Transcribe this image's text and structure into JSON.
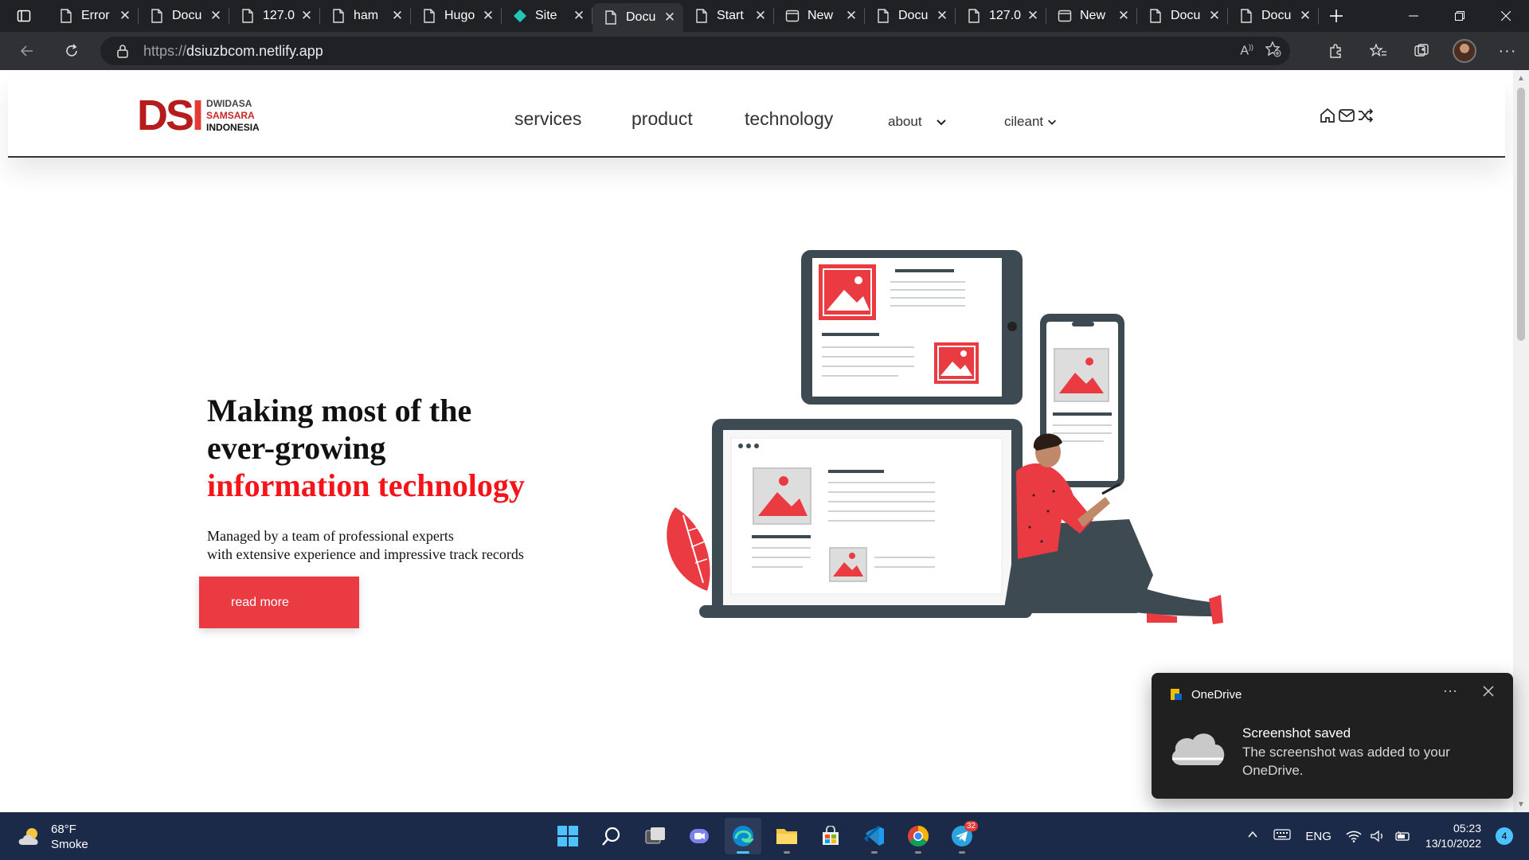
{
  "browser": {
    "tabs": [
      {
        "title": "Error",
        "icon": "page-icon"
      },
      {
        "title": "Docu",
        "icon": "page-icon"
      },
      {
        "title": "127.0",
        "icon": "page-icon"
      },
      {
        "title": "ham",
        "icon": "page-icon"
      },
      {
        "title": "Hugo",
        "icon": "page-icon"
      },
      {
        "title": "Site",
        "icon": "netlify-icon"
      },
      {
        "title": "Docu",
        "icon": "page-icon",
        "active": true
      },
      {
        "title": "Start",
        "icon": "page-icon"
      },
      {
        "title": "New",
        "icon": "newtab-icon"
      },
      {
        "title": "Docu",
        "icon": "page-icon"
      },
      {
        "title": "127.0",
        "icon": "page-icon"
      },
      {
        "title": "New",
        "icon": "newtab-icon"
      },
      {
        "title": "Docu",
        "icon": "page-icon"
      },
      {
        "title": "Docu",
        "icon": "page-icon"
      }
    ],
    "url_scheme": "https://",
    "url_host": "dsiuzbcom.netlify.app"
  },
  "site": {
    "logo": {
      "mark": "DS",
      "mark_accent": "I",
      "line1": "DWIDASA",
      "line2": "SAMSARA",
      "line3": "INDONESIA"
    },
    "nav": [
      {
        "label": "services"
      },
      {
        "label": "product"
      },
      {
        "label": "technology"
      },
      {
        "label": "about"
      },
      {
        "label": "cileant"
      }
    ],
    "hero": {
      "title_line1": "Making most of the",
      "title_line2": "ever-growing",
      "title_highlight": "information technology",
      "subtitle_line1": "Managed by a team of professional experts",
      "subtitle_line2": "with extensive experience and impressive track records",
      "cta_label": "read more"
    },
    "colors": {
      "brand_red": "#ea3b43",
      "highlight_red": "#f5141a",
      "device_dark": "#3d4a52"
    }
  },
  "toast": {
    "app": "OneDrive",
    "title": "Screenshot saved",
    "body": "The screenshot was added to your OneDrive."
  },
  "taskbar": {
    "weather_temp": "68°F",
    "weather_desc": "Smoke",
    "telegram_badge": "32",
    "language": "ENG",
    "time": "05:23",
    "date": "13/10/2022",
    "notification_count": "4"
  }
}
